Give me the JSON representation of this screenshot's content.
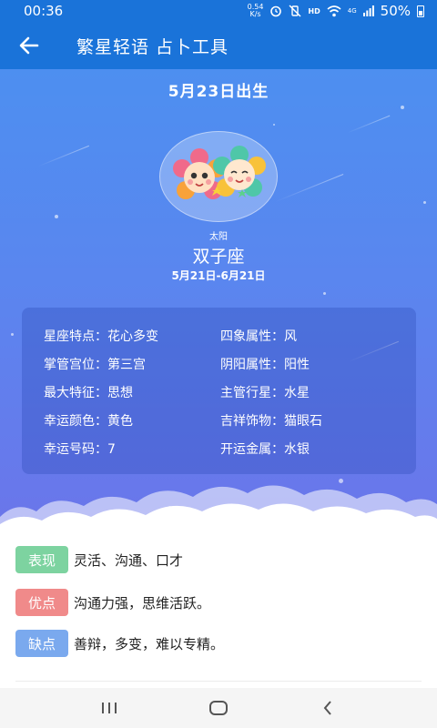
{
  "status": {
    "time": "00:36",
    "speed_value": "0.54",
    "speed_unit": "K/s",
    "network": "HD",
    "signal": "4G",
    "battery": "50%"
  },
  "app_bar": {
    "title": "繁星轻语 占卜工具"
  },
  "hero": {
    "birth_date": "5月23日出生",
    "sun_label": "太阳",
    "sign": "双子座",
    "date_range": "5月21日-6月21日"
  },
  "info": [
    [
      {
        "label": "星座特点：",
        "value": "花心多变"
      },
      {
        "label": "四象属性：",
        "value": "风"
      }
    ],
    [
      {
        "label": "掌管宫位：",
        "value": "第三宫"
      },
      {
        "label": "阴阳属性：",
        "value": "阳性"
      }
    ],
    [
      {
        "label": "最大特征：",
        "value": "思想"
      },
      {
        "label": "主管行星：",
        "value": "水星"
      }
    ],
    [
      {
        "label": "幸运颜色：",
        "value": "黄色"
      },
      {
        "label": "吉祥饰物：",
        "value": "猫眼石"
      }
    ],
    [
      {
        "label": "幸运号码：",
        "value": "7"
      },
      {
        "label": "开运金属：",
        "value": "水银"
      }
    ]
  ],
  "traits": [
    {
      "tag": "表现",
      "text": "灵活、沟通、口才",
      "color": "#7dd3a0"
    },
    {
      "tag": "优点",
      "text": "沟通力强，思维活跃。",
      "color": "#f08a8a"
    },
    {
      "tag": "缺点",
      "text": "善辩，多变，难以专精。",
      "color": "#7aa9ee"
    }
  ],
  "colors": {
    "primary": "#1a73d9",
    "hero_top": "#4d8ff0",
    "hero_bottom": "#6b75ea"
  },
  "icons": {
    "back": "arrow-left-icon",
    "avatar": "gemini-twins-flowers-icon",
    "nav_recent": "recent-apps-icon",
    "nav_home": "home-icon",
    "nav_back": "chevron-left-icon"
  }
}
